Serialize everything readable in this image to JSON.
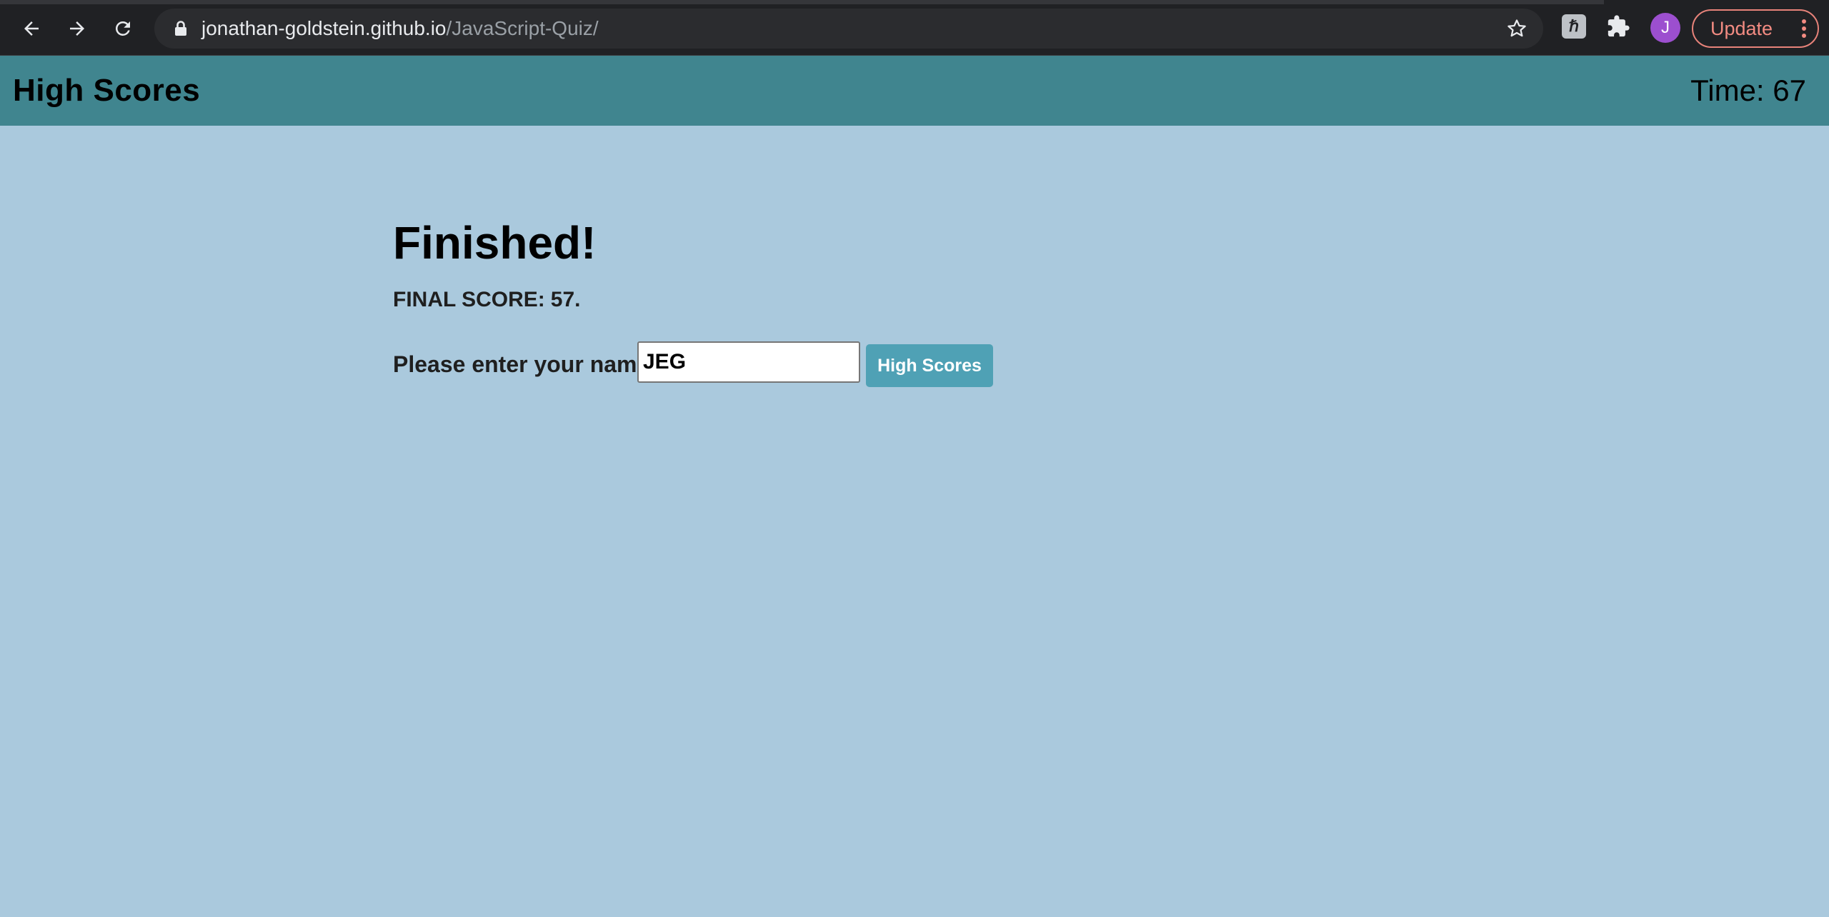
{
  "browser": {
    "url_host": "jonathan-goldstein.github.io",
    "url_path": "/JavaScript-Quiz/",
    "avatar_letter": "J",
    "update_label": "Update",
    "extension_icon": "extension-icon"
  },
  "header": {
    "high_scores_link": "High Scores",
    "time_label": "Time:",
    "time_value": "67"
  },
  "main": {
    "title": "Finished!",
    "final_score_label": "FINAL SCORE:",
    "final_score_value": "57.",
    "name_prompt": "Please enter your name:",
    "name_value": "JEG",
    "submit_label": "High Scores"
  },
  "colors": {
    "page_background": "#aac9dd",
    "header_background": "#40858f",
    "button_background": "#4fa1b5",
    "browser_chrome": "#202124"
  }
}
